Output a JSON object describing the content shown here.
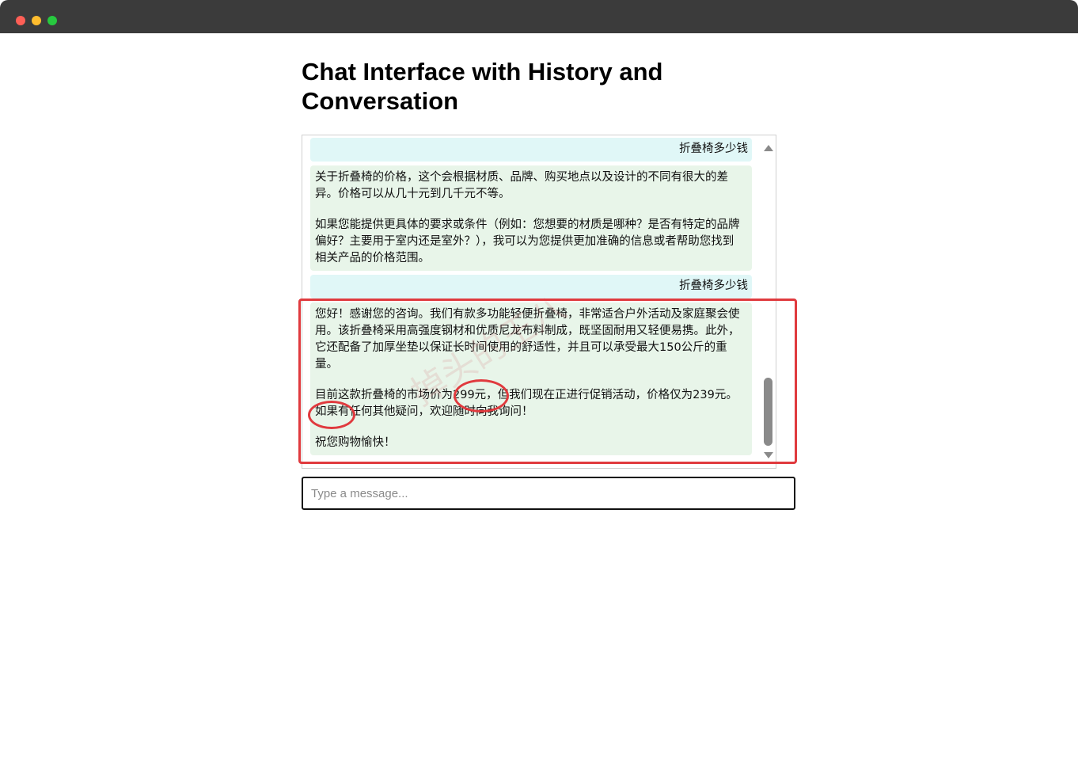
{
  "page": {
    "title": "Chat Interface with History and Conversation"
  },
  "chat": {
    "messages": [
      {
        "role": "user",
        "text": "折叠椅多少钱"
      },
      {
        "role": "bot",
        "paragraphs": [
          "关于折叠椅的价格，这个会根据材质、品牌、购买地点以及设计的不同有很大的差异。价格可以从几十元到几千元不等。",
          "如果您能提供更具体的要求或条件（例如：您想要的材质是哪种？是否有特定的品牌偏好？主要用于室内还是室外？），我可以为您提供更加准确的信息或者帮助您找到相关产品的价格范围。"
        ]
      },
      {
        "role": "user",
        "text": "折叠椅多少钱"
      },
      {
        "role": "bot",
        "paragraphs": [
          "您好！感谢您的咨询。我们有款多功能轻便折叠椅，非常适合户外活动及家庭聚会使用。该折叠椅采用高强度钢材和优质尼龙布料制成，既坚固耐用又轻便易携。此外，它还配备了加厚坐垫以保证长时间使用的舒适性，并且可以承受最大150公斤的重量。",
          "目前这款折叠椅的市场价为299元，但我们现在正进行促销活动，价格仅为239元。如果有任何其他疑问，欢迎随时向我询问！",
          "祝您购物愉快！"
        ]
      }
    ]
  },
  "input": {
    "placeholder": "Type a message..."
  },
  "watermark": {
    "text": "掉头的王八"
  },
  "colors": {
    "user_bubble": "#e0f7f7",
    "bot_bubble": "#e8f5e9",
    "annotation": "#e03a3e",
    "titlebar": "#3b3b3b"
  }
}
